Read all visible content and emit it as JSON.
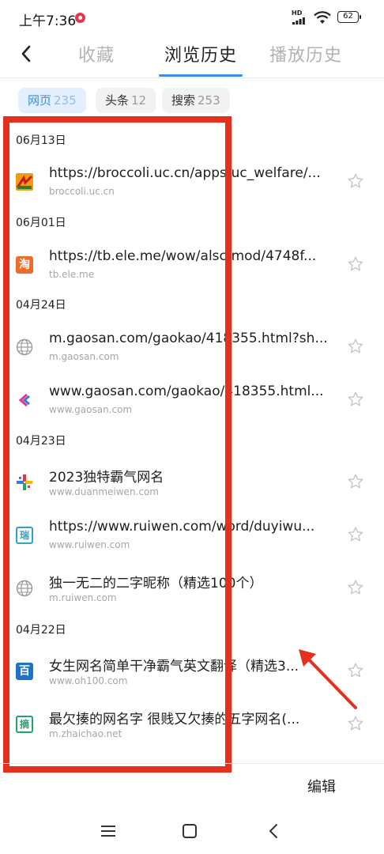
{
  "status_bar": {
    "time": "上午7:36",
    "hd_label": "HD",
    "battery": "62"
  },
  "header": {
    "tabs": [
      {
        "label": "收藏",
        "active": false
      },
      {
        "label": "浏览历史",
        "active": true
      },
      {
        "label": "播放历史",
        "active": false
      }
    ]
  },
  "filters": [
    {
      "label": "网页",
      "count": "235",
      "active": true
    },
    {
      "label": "头条",
      "count": "12",
      "active": false
    },
    {
      "label": "搜索",
      "count": "253",
      "active": false
    }
  ],
  "history": {
    "groups": [
      {
        "date": "06月13日",
        "items": [
          {
            "title": "https://broccoli.uc.cn/apps/uc_welfare/...",
            "domain": "broccoli.uc.cn",
            "icon": "uc-welfare-icon"
          }
        ]
      },
      {
        "date": "06月01日",
        "items": [
          {
            "title": "https://tb.ele.me/wow/alsc/mod/4748f...",
            "domain": "tb.ele.me",
            "icon": "taobao-icon",
            "icon_text": "淘"
          }
        ]
      },
      {
        "date": "04月24日",
        "items": [
          {
            "title": "m.gaosan.com/gaokao/418355.html?sh...",
            "domain": "m.gaosan.com",
            "icon": "globe-icon"
          },
          {
            "title": "www.gaosan.com/gaokao/418355.html...",
            "domain": "www.gaosan.com",
            "icon": "gaosan-icon"
          }
        ]
      },
      {
        "date": "04月23日",
        "items": [
          {
            "title": "2023独特霸气网名",
            "domain": "www.duanmeiwen.com",
            "icon": "pinwheel-icon"
          },
          {
            "title": "https://www.ruiwen.com/word/duyiwu...",
            "domain": "www.ruiwen.com",
            "icon": "ruiwen-icon",
            "icon_text": "瑞"
          },
          {
            "title": "独一无二的二字昵称（精选100个）",
            "domain": "m.ruiwen.com",
            "icon": "globe-icon"
          }
        ]
      },
      {
        "date": "04月22日",
        "items": [
          {
            "title": "女生网名简单干净霸气英文翻译（精选3...",
            "domain": "www.oh100.com",
            "icon": "baidu-bai-icon",
            "icon_text": "百"
          },
          {
            "title": "最欠揍的网名字 很贱又欠揍的五字网名(...",
            "domain": "m.zhaichao.net",
            "icon": "zhaichao-icon",
            "icon_text": "摘"
          }
        ]
      }
    ]
  },
  "footer": {
    "edit_label": "编辑"
  },
  "colors": {
    "accent": "#3a8ee6",
    "annotation": "#e5301e"
  }
}
